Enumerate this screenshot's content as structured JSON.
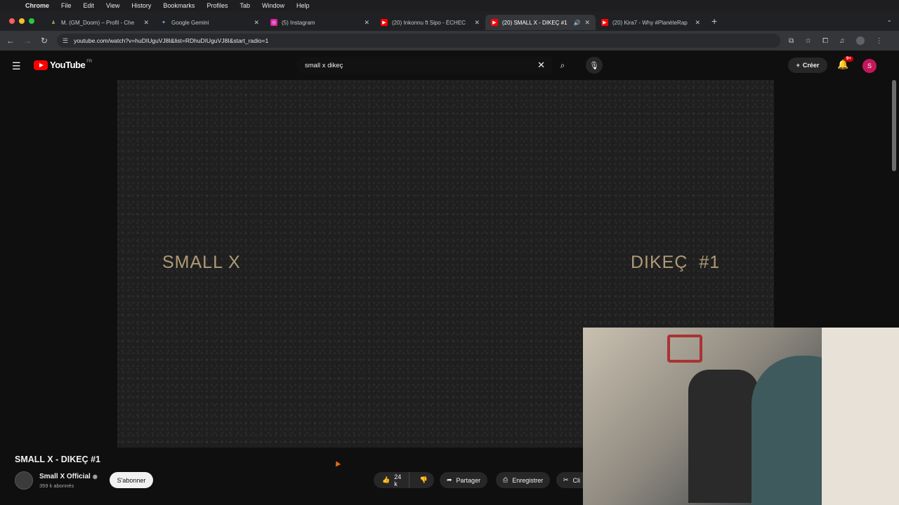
{
  "os_menu": {
    "app": "Chrome",
    "items": [
      "File",
      "Edit",
      "View",
      "History",
      "Bookmarks",
      "Profiles",
      "Tab",
      "Window",
      "Help"
    ]
  },
  "tabs": [
    {
      "title": "M. (GM_Doom) – Profil - Che",
      "icon": "chess-icon",
      "active": false
    },
    {
      "title": "Google Gemini",
      "icon": "gemini-icon",
      "active": false
    },
    {
      "title": "(5) Instagram",
      "icon": "instagram-icon",
      "active": false
    },
    {
      "title": "(20) Inkonnu ft Sipo - ÉCHEC",
      "icon": "youtube-icon",
      "active": false
    },
    {
      "title": "(20) SMALL X - DIKEÇ #1",
      "icon": "youtube-icon",
      "active": true
    },
    {
      "title": "(20) Kira7 - Why #PlanèteRap",
      "icon": "youtube-icon",
      "active": false
    }
  ],
  "address": {
    "url": "youtube.com/watch?v=huDIUguVJ8I&list=RDhuDIUguVJ8I&start_radio=1"
  },
  "youtube": {
    "logo": "YouTube",
    "region": "FR",
    "search_value": "small x dikeç",
    "create_label": "Créer",
    "notif_badge": "9+",
    "avatar_letter": "S"
  },
  "video": {
    "left_text": "SMALL X",
    "right_text": "DIKEÇ #1",
    "title": "SMALL X - DIKEÇ #1",
    "channel": "Small X Official",
    "subscribers": "359 k abonnés",
    "subscribe_label": "S'abonner",
    "likes": "24 k",
    "share_label": "Partager",
    "save_label": "Enregistrer",
    "clip_label": "Cli"
  },
  "colors": {
    "accent": "#ff0000",
    "video_text": "#b09a78"
  }
}
